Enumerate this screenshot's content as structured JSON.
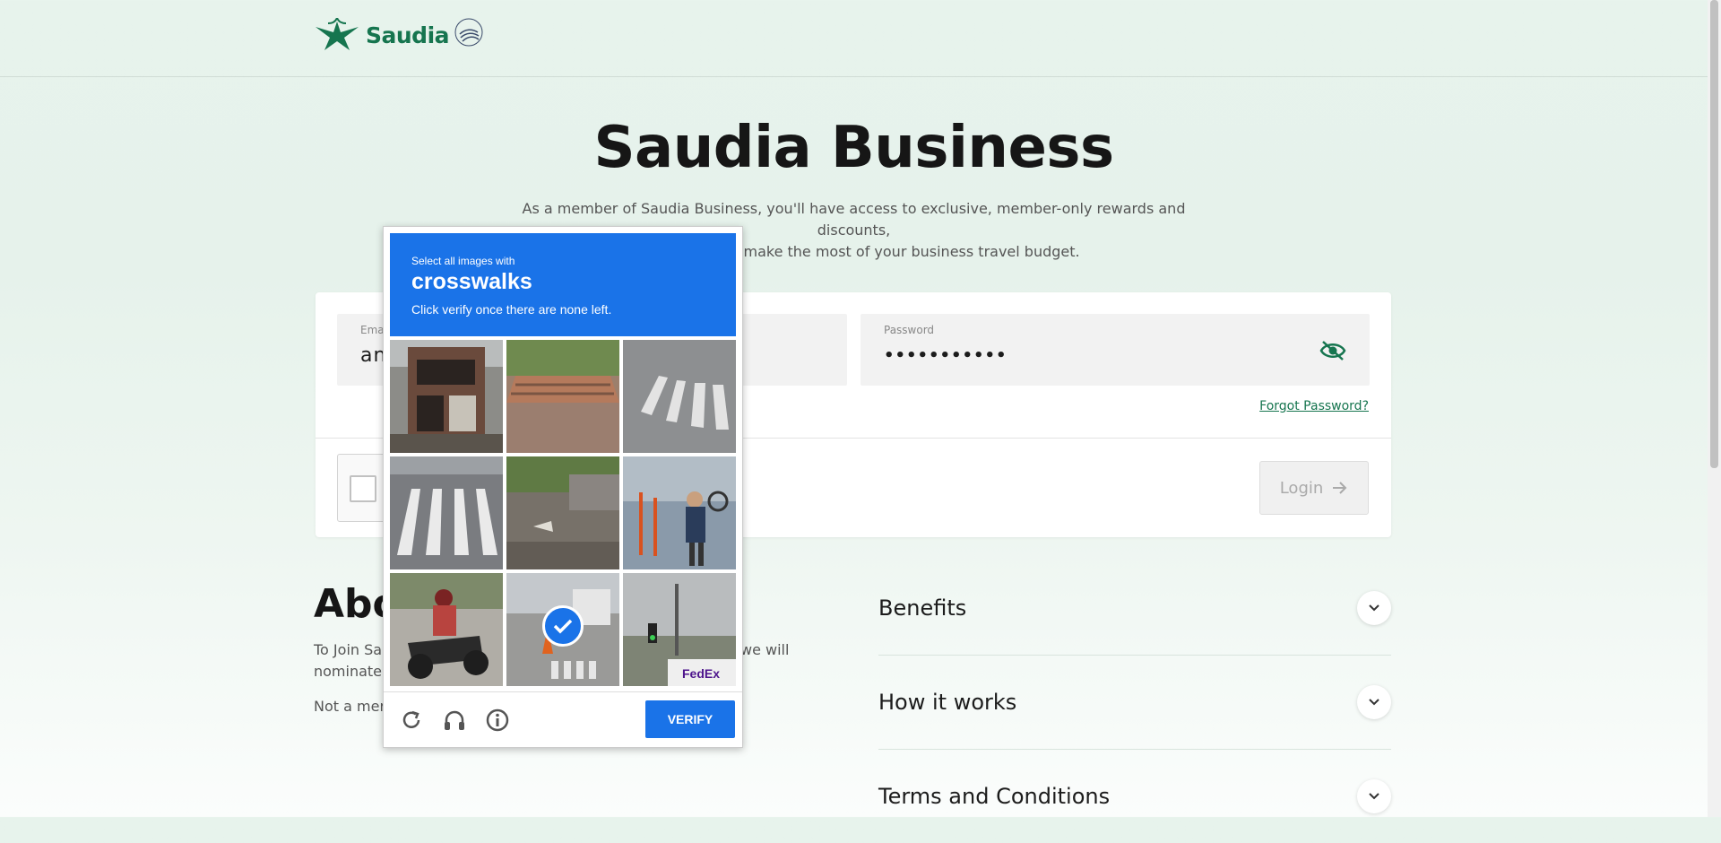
{
  "header": {
    "brand_name": "Saudia",
    "skyteam_label": "SKYTEAM"
  },
  "hero": {
    "title": "Saudia Business",
    "subtitle_line1": "As a member of Saudia Business, you'll have access to exclusive, member-only rewards and discounts,",
    "subtitle_line2": "so that you can make the most of your business travel budget."
  },
  "login": {
    "email_label": "Email",
    "email_value": "an",
    "password_label": "Password",
    "password_value": "•••••••••••",
    "forgot_label": "Forgot Password?",
    "login_label": "Login"
  },
  "about": {
    "title": "Abo",
    "text_start": "To Join Sa",
    "text_end": "we will",
    "text_line2": "nominate",
    "text2": "Not a mer"
  },
  "accordion": [
    {
      "label": "Benefits"
    },
    {
      "label": "How it works"
    },
    {
      "label": "Terms and Conditions"
    }
  ],
  "recaptcha": {
    "instruction": "Select all images with",
    "target": "crosswalks",
    "hint": "Click verify once there are none left.",
    "verify_label": "VERIFY",
    "tiles": [
      {
        "subject": "building",
        "selected": false
      },
      {
        "subject": "stairs",
        "selected": false
      },
      {
        "subject": "crosswalk",
        "selected": false
      },
      {
        "subject": "crosswalk",
        "selected": false
      },
      {
        "subject": "grass-road",
        "selected": false
      },
      {
        "subject": "street-person",
        "selected": false
      },
      {
        "subject": "motorcycle",
        "selected": true
      },
      {
        "subject": "street-cones",
        "selected": true
      },
      {
        "subject": "traffic-light",
        "selected": false
      }
    ],
    "fedex_text": "FedEx"
  },
  "colors": {
    "brand_green": "#16754f",
    "recaptcha_blue": "#1a73e8"
  }
}
